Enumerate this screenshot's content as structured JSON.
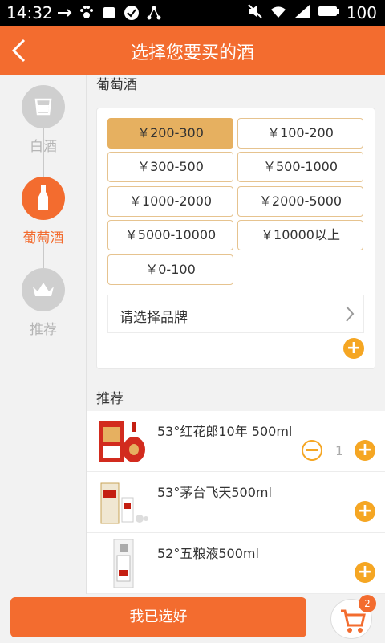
{
  "status_bar": {
    "time": "14:32",
    "battery": "100"
  },
  "header": {
    "title": "选择您要买的酒"
  },
  "sidebar": {
    "items": [
      {
        "label": "白酒"
      },
      {
        "label": "葡萄酒"
      },
      {
        "label": "推荐"
      }
    ]
  },
  "filter": {
    "section_title": "葡萄酒",
    "prices": [
      {
        "label": "￥200-300",
        "selected": true
      },
      {
        "label": "￥100-200",
        "selected": false
      },
      {
        "label": "￥300-500",
        "selected": false
      },
      {
        "label": "￥500-1000",
        "selected": false
      },
      {
        "label": "￥1000-2000",
        "selected": false
      },
      {
        "label": "￥2000-5000",
        "selected": false
      },
      {
        "label": "￥5000-10000",
        "selected": false
      },
      {
        "label": "￥10000以上",
        "selected": false
      },
      {
        "label": "￥0-100",
        "selected": false
      }
    ],
    "brand_placeholder": "请选择品牌",
    "add_symbol": "+"
  },
  "recommend": {
    "title": "推荐",
    "products": [
      {
        "name": "53°红花郎10年 500ml",
        "quantity": "1"
      },
      {
        "name": "53°茅台飞天500ml"
      },
      {
        "name": "52°五粮液500ml"
      }
    ]
  },
  "footer": {
    "confirm_label": "我已选好",
    "cart_count": "2"
  },
  "colors": {
    "brand": "#f36c2f",
    "accent": "#f5a623",
    "selected_price": "#e6b060"
  }
}
